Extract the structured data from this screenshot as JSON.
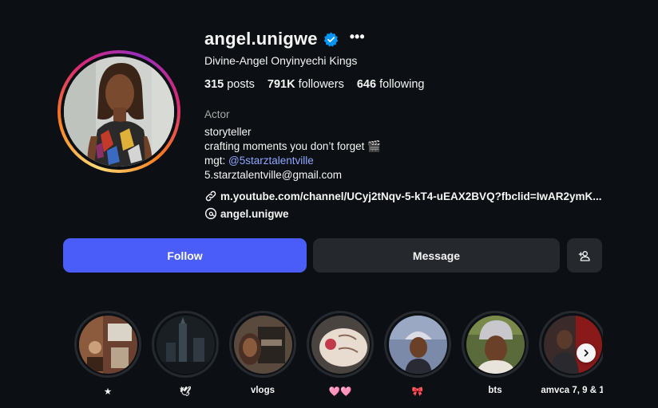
{
  "profile": {
    "username": "angel.unigwe",
    "more_icon": "•••",
    "full_name": "Divine-Angel Onyinyechi Kings",
    "stats": {
      "posts_count": "315",
      "posts_label": "posts",
      "followers_count": "791K",
      "followers_label": "followers",
      "following_count": "646",
      "following_label": "following"
    },
    "category": "Actor",
    "bio": {
      "line1": "storyteller",
      "line2": "crafting moments you don’t forget 🎬",
      "line3_prefix": "mgt: ",
      "line3_mention": "@5starztalentville",
      "line4": "5.starztalentville@gmail.com"
    },
    "link": "m.youtube.com/channel/UCyj2tNqv-5-kT4-uEAX2BVQ?fbclid=IwAR2ymK...",
    "threads_handle": "angel.unigwe"
  },
  "actions": {
    "follow_label": "Follow",
    "message_label": "Message",
    "suggest_icon": "add-person-icon"
  },
  "highlights": [
    {
      "label": "★"
    },
    {
      "label": "🕊"
    },
    {
      "label": "vlogs"
    },
    {
      "label": "🩷🩷"
    },
    {
      "label": "🎀"
    },
    {
      "label": "bts"
    },
    {
      "label": "amvca 7, 9 & 1"
    }
  ],
  "colors": {
    "background": "#0c1014",
    "follow_button": "#4a5df9",
    "secondary_button": "#25292e",
    "mention": "#8fa7ff",
    "verified": "#0095f6"
  }
}
